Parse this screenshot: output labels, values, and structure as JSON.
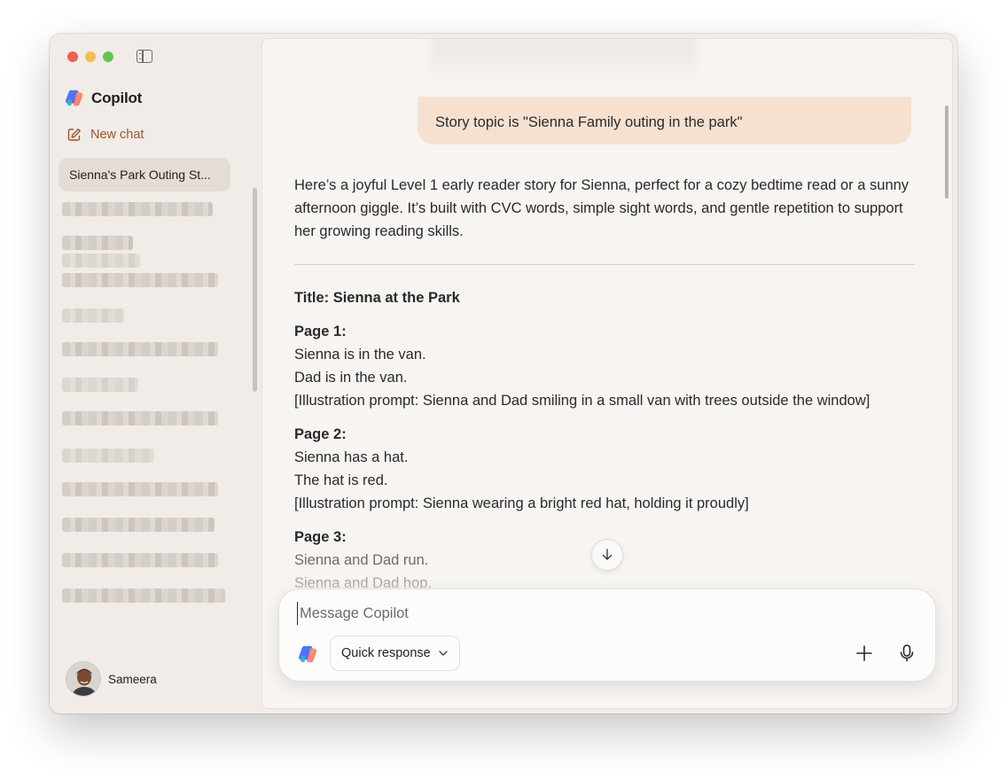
{
  "app": {
    "name": "Copilot"
  },
  "sidebar": {
    "new_chat_label": "New chat",
    "active_chat_title": "Sienna's Park Outing St...",
    "user_name": "Sameera"
  },
  "conversation": {
    "user_message": "Story topic is \"Sienna Family outing in the park\"",
    "intro": "Here’s a joyful Level 1 early reader story for Sienna, perfect for a cozy bedtime read or a sunny afternoon giggle. It’s built with CVC words, simple sight words, and gentle repetition to support her growing reading skills.",
    "story_title": "Title: Sienna at the Park",
    "pages": [
      {
        "heading": "Page 1:",
        "lines": [
          "Sienna is in the van.",
          "Dad is in the van.",
          "[Illustration prompt: Sienna and Dad smiling in a small van with trees outside the window]"
        ]
      },
      {
        "heading": "Page 2:",
        "lines": [
          "Sienna has a hat.",
          "The hat is red.",
          "[Illustration prompt: Sienna wearing a bright red hat, holding it proudly]"
        ]
      },
      {
        "heading": "Page 3:",
        "lines": [
          "Sienna and Dad run.",
          "Sienna and Dad hop."
        ]
      }
    ]
  },
  "composer": {
    "placeholder": "Message Copilot",
    "mode_label": "Quick response"
  },
  "colors": {
    "accent": "#a3502b",
    "user_bubble": "#f6e1d1",
    "sidebar_bg": "#f1ece7",
    "main_bg": "#f7f4f1"
  },
  "icons": [
    "sidebar-toggle-icon",
    "copilot-logo-icon",
    "compose-icon",
    "arrow-down-icon",
    "chevron-down-icon",
    "plus-icon",
    "microphone-icon"
  ]
}
